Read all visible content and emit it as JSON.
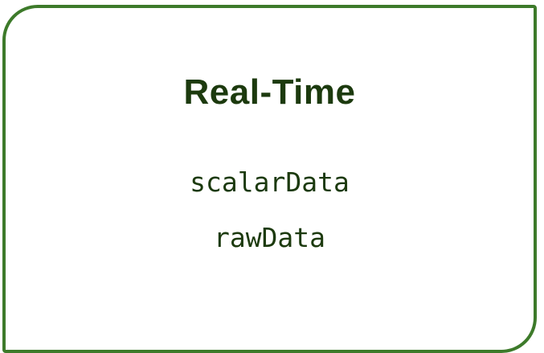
{
  "card": {
    "title": "Real-Time",
    "items": [
      "scalarData",
      "rawData"
    ],
    "border_color": "#3d7a2a",
    "text_color": "#1c3a0e"
  }
}
